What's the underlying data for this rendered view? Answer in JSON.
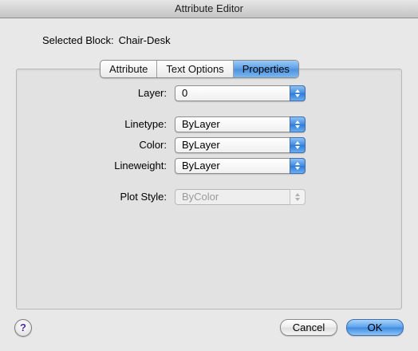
{
  "window": {
    "title": "Attribute Editor"
  },
  "selected_block": {
    "label": "Selected Block:",
    "value": "Chair-Desk"
  },
  "tabs": [
    {
      "label": "Attribute",
      "active": false
    },
    {
      "label": "Text Options",
      "active": false
    },
    {
      "label": "Properties",
      "active": true
    }
  ],
  "properties": {
    "layer": {
      "label": "Layer:",
      "value": "0"
    },
    "linetype": {
      "label": "Linetype:",
      "value": "ByLayer"
    },
    "color": {
      "label": "Color:",
      "value": "ByLayer"
    },
    "lineweight": {
      "label": "Lineweight:",
      "value": "ByLayer"
    },
    "plot_style": {
      "label": "Plot Style:",
      "value": "ByColor",
      "enabled": false
    }
  },
  "buttons": {
    "help": "?",
    "cancel": "Cancel",
    "ok": "OK"
  },
  "colors": {
    "accent": "#3d8ae0"
  }
}
